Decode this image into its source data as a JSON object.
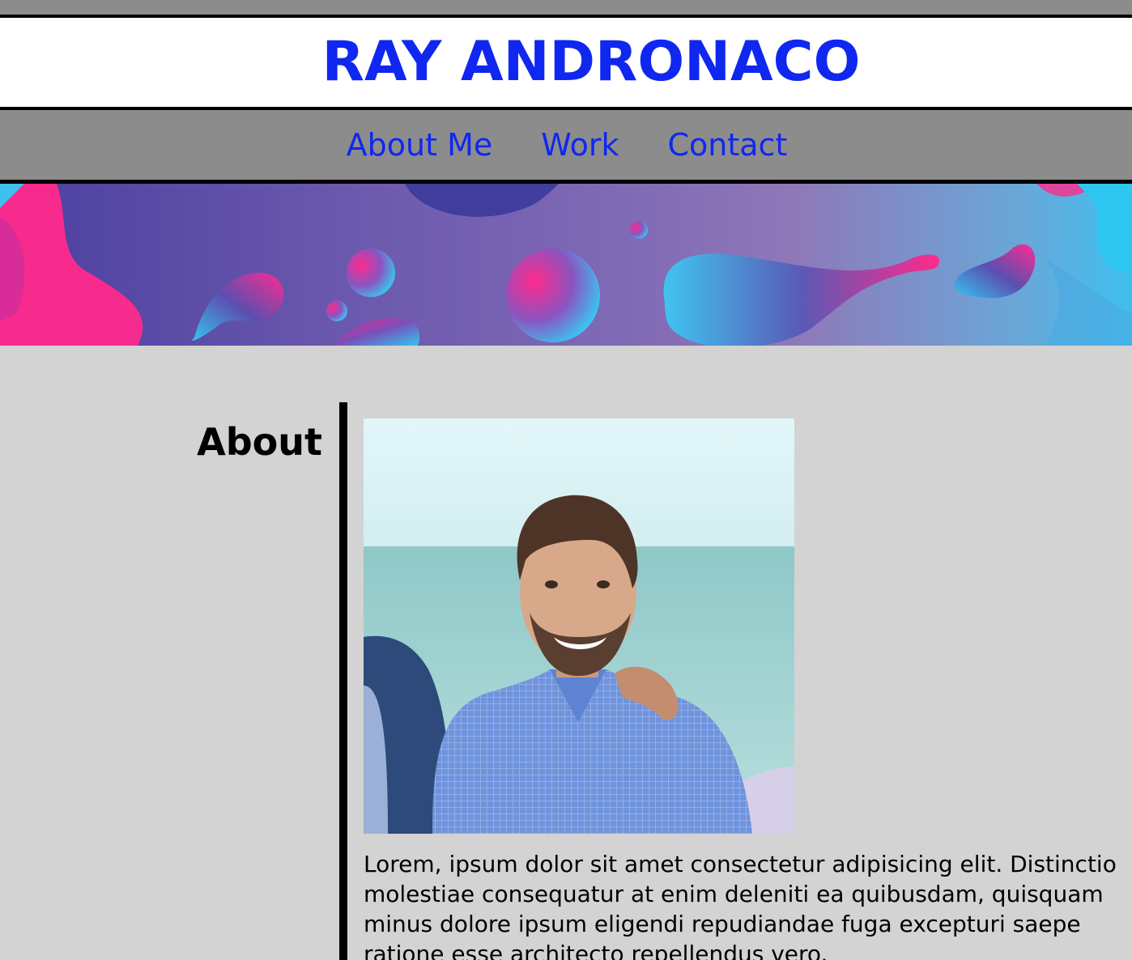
{
  "header": {
    "title": "RAY ANDRONACO"
  },
  "nav": {
    "items": [
      {
        "label": "About Me"
      },
      {
        "label": "Work"
      },
      {
        "label": "Contact"
      }
    ]
  },
  "about": {
    "heading": "About",
    "bio": "Lorem, ipsum dolor sit amet consectetur adipisicing elit. Distinctio molestiae consequatur at enim deleniti ea quibusdam, quisquam minus dolore ipsum eligendi repudiandae fuga excepturi saepe ratione esse architecto repellendus vero."
  },
  "colors": {
    "accent": "#1027f0",
    "nav_bg": "#8c8c8c",
    "page_bg": "#d3d3d3"
  }
}
